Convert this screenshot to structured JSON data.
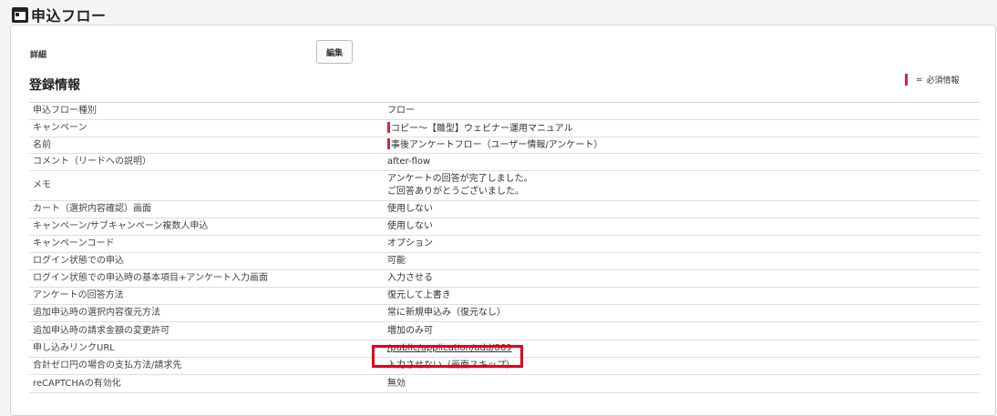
{
  "header": {
    "title": "申込フロー",
    "icon": "calendar-icon"
  },
  "detail": {
    "label": "詳細",
    "edit_label": "編集"
  },
  "section": {
    "title": "登録情報"
  },
  "legend": {
    "equals": "=",
    "text": "必須情報",
    "color": "#c0313f"
  },
  "rows": [
    {
      "label": "申込フロー種別",
      "value": "フロー",
      "required": false
    },
    {
      "label": "キャンペーン",
      "value": "コピー～【雛型】ウェビナー運用マニュアル",
      "required": true
    },
    {
      "label": "名前",
      "value": "事後アンケートフロー（ユーザー情報/アンケート）",
      "required": true
    },
    {
      "label": "コメント（リードへの説明）",
      "value": "after-flow",
      "required": false
    },
    {
      "label": "メモ",
      "value": "アンケートの回答が完了しました。",
      "value2": "ご回答ありがとうございました。",
      "required": false
    },
    {
      "label": "カート（選択内容確認）画面",
      "value": "使用しない",
      "required": false
    },
    {
      "label": "キャンペーン/サブキャンペーン複数人申込",
      "value": "使用しない",
      "required": false
    },
    {
      "label": "キャンペーンコード",
      "value": "オプション",
      "required": false
    },
    {
      "label": "ログイン状態での申込",
      "value": "可能",
      "required": false
    },
    {
      "label": "ログイン状態での申込時の基本項目+アンケート入力画面",
      "value": "入力させる",
      "required": false
    },
    {
      "label": "アンケートの回答方法",
      "value": "復元して上書き",
      "required": false
    },
    {
      "label": "追加申込時の選択内容復元方法",
      "value": "常に新規申込み（復元なし）",
      "required": false
    },
    {
      "label": "追加申込時の請求金額の変更許可",
      "value": "増加のみ可",
      "required": false
    },
    {
      "label": "申し込みリンクURL",
      "value": "/public/application/add/869",
      "required": false
    },
    {
      "label": "合計ゼロ円の場合の支払方法/請求先",
      "value": "入力させない（画面スキップ）",
      "required": false
    },
    {
      "label": "reCAPTCHAの有効化",
      "value": "無効",
      "required": false
    }
  ]
}
